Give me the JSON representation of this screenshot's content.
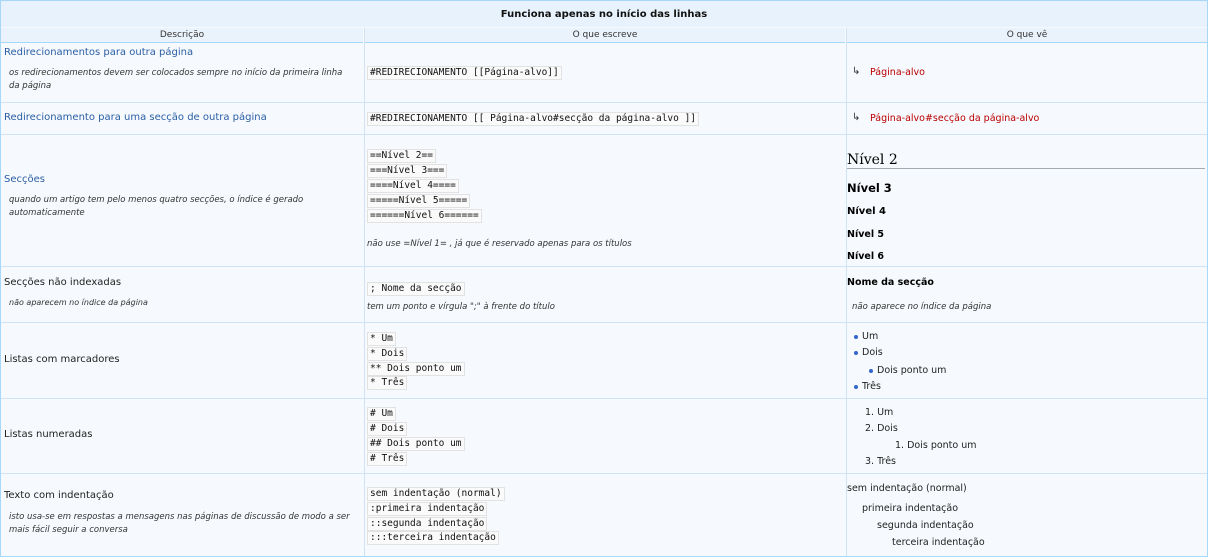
{
  "title": "Funciona apenas no início das linhas",
  "headers": [
    "Descrição",
    "O que escreve",
    "O que vê"
  ],
  "rows": {
    "redirect": {
      "label": "Redirecionamentos para outra página",
      "note": "os redirecionamentos devem ser colocados sempre no início da primeira linha da página",
      "code": "#REDIRECIONAMENTO [[Página-alvo]]",
      "arrow": "↳",
      "result": "Página-alvo"
    },
    "redirect_section": {
      "label": "Redirecionamento para uma secção de outra página",
      "code": "#REDIRECIONAMENTO [[ Página-alvo#secção da página-alvo ]]",
      "arrow": "↳",
      "result": "Página-alvo#secção da página-alvo"
    },
    "sections": {
      "label": "Secções",
      "note": "quando um artigo tem pelo menos quatro secções, o índice é gerado automaticamente",
      "code": [
        "==Nível 2==",
        "===Nível 3===",
        "====Nível 4====",
        "=====Nível 5=====",
        "======Nível 6======"
      ],
      "hint": "não use  =Nível 1=  , já que é reservado apenas para os títulos",
      "out": [
        "Nível 2",
        "Nível 3",
        "Nível 4",
        "Nível 5",
        "Nível 6"
      ]
    },
    "unindexed": {
      "label": "Secções não indexadas",
      "note": "não aparecem no índice da página",
      "code": "; Nome da secção",
      "hint": "tem um ponto e vírgula \";\" à frente do título",
      "out": "Nome da secção",
      "out_note": "não aparece no índice da página"
    },
    "bullets": {
      "label": "Listas com marcadores",
      "code": [
        "* Um",
        "* Dois",
        "** Dois ponto um",
        "* Três"
      ],
      "out": [
        "Um",
        "Dois",
        "Dois ponto um",
        "Três"
      ]
    },
    "numbered": {
      "label": "Listas numeradas",
      "code": [
        "# Um",
        "# Dois",
        "## Dois ponto um",
        "# Três"
      ],
      "out": [
        "1. Um",
        "2. Dois",
        "1. Dois ponto um",
        "3. Três"
      ]
    },
    "indent": {
      "label": "Texto com indentação",
      "note": "isto usa-se em respostas a mensagens nas páginas de discussão de modo a ser mais fácil seguir a conversa",
      "code": [
        "sem indentação (normal)",
        ":primeira indentação",
        "::segunda indentação",
        ":::terceira indentação"
      ],
      "out": [
        "sem indentação (normal)",
        "primeira indentação",
        "segunda indentação",
        "terceira indentação"
      ]
    }
  }
}
